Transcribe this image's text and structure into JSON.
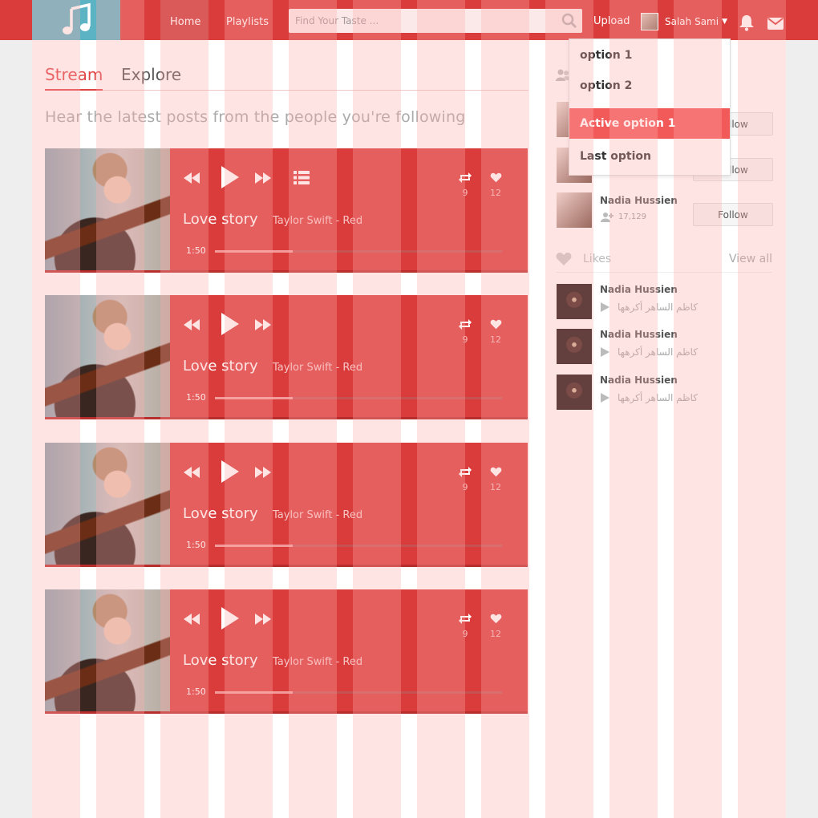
{
  "header": {
    "nav": {
      "home": "Home",
      "playlists": "Playlists"
    },
    "search": {
      "placeholder": "Find Your Taste ..."
    },
    "upload": "Upload",
    "user": {
      "name": "Salah Sami"
    },
    "icons": [
      "music-logo-icon",
      "search-icon",
      "bell-icon",
      "mail-icon"
    ]
  },
  "main": {
    "tabs": [
      "Stream",
      "Explore"
    ],
    "subtitle": "Hear the latest posts from the people you're following",
    "players": [
      {
        "title": "Love story",
        "artist": "Taylor Swift - Red",
        "time": "1:50",
        "reposts": "9",
        "likes": "12",
        "progress": 0.27,
        "show_list": true
      },
      {
        "title": "Love story",
        "artist": "Taylor Swift - Red",
        "time": "1:50",
        "reposts": "9",
        "likes": "12",
        "progress": 0.27,
        "show_list": false
      },
      {
        "title": "Love story",
        "artist": "Taylor Swift - Red",
        "time": "1:50",
        "reposts": "9",
        "likes": "12",
        "progress": 0.27,
        "show_list": false
      },
      {
        "title": "Love story",
        "artist": "Taylor Swift - Red",
        "time": "1:50",
        "reposts": "9",
        "likes": "12",
        "progress": 0.27,
        "show_list": false
      }
    ]
  },
  "sidebar": {
    "who_to_follow": [
      {
        "name": "",
        "followers": "",
        "button": "Follow"
      },
      {
        "name": "",
        "followers": "",
        "button": "Follow"
      },
      {
        "name": "Nadia Hussien",
        "followers": "17,129",
        "button": "Follow"
      }
    ],
    "likes": {
      "title": "Likes",
      "view_all": "View all",
      "items": [
        {
          "name": "Nadia Hussien",
          "song": "كاظم الساهر أكرهها"
        },
        {
          "name": "Nadia Hussien",
          "song": "كاظم الساهر أكرهها"
        },
        {
          "name": "Nadia Hussien",
          "song": "كاظم الساهر أكرهها"
        }
      ]
    }
  },
  "dropdown": {
    "items": [
      "option 1",
      "option 2",
      "Active option 1",
      "Last option"
    ],
    "active_index": 2
  },
  "colors": {
    "primary": "#d93c3b",
    "logo_bg": "#5cb3c4",
    "active_menu": "#f25a5a"
  }
}
